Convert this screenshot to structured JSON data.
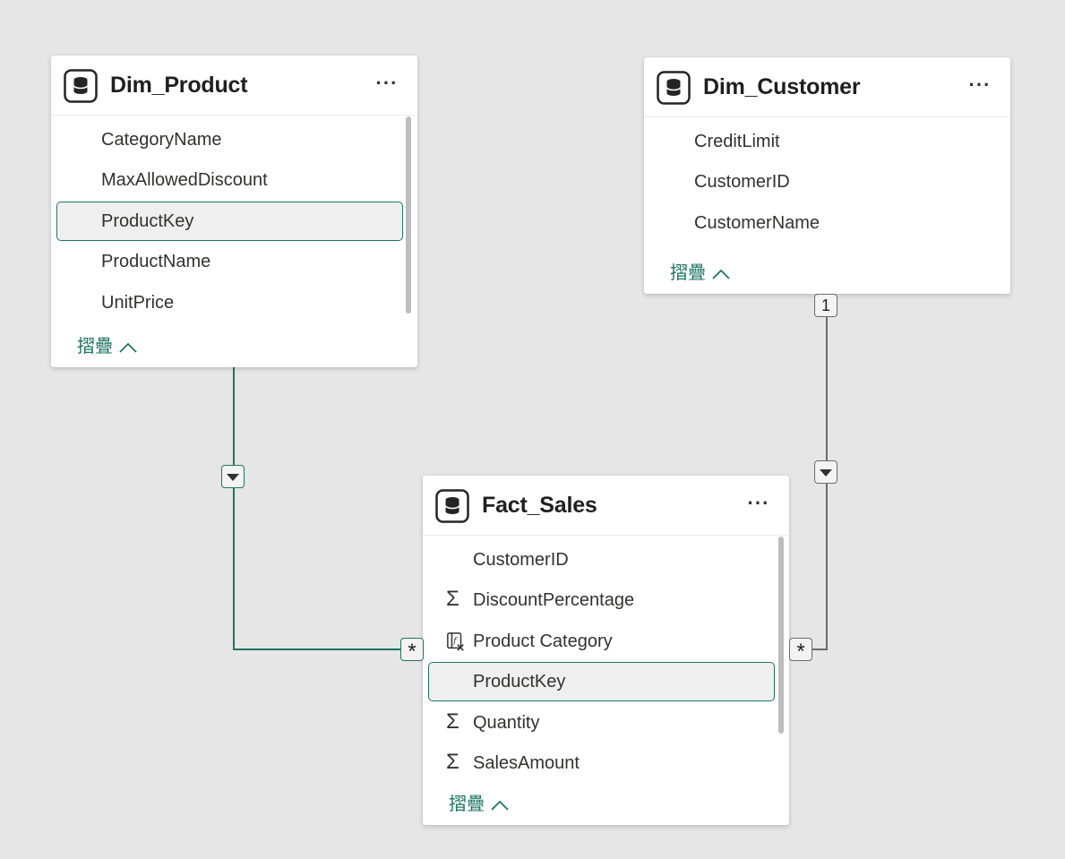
{
  "tables": {
    "dim_product": {
      "title": "Dim_Product",
      "more_label": "···",
      "fields": [
        {
          "name": "CategoryName"
        },
        {
          "name": "MaxAllowedDiscount"
        },
        {
          "name": "ProductKey"
        },
        {
          "name": "ProductName"
        },
        {
          "name": "UnitPrice"
        }
      ],
      "collapse_label": "摺疊"
    },
    "dim_customer": {
      "title": "Dim_Customer",
      "more_label": "···",
      "fields": [
        {
          "name": "CreditLimit"
        },
        {
          "name": "CustomerID"
        },
        {
          "name": "CustomerName"
        }
      ],
      "collapse_label": "摺疊"
    },
    "fact_sales": {
      "title": "Fact_Sales",
      "more_label": "···",
      "fields": [
        {
          "name": "CustomerID"
        },
        {
          "name": "DiscountPercentage",
          "icon": "sigma-icon"
        },
        {
          "name": "Product Category",
          "icon": "calculated-column-icon"
        },
        {
          "name": "ProductKey"
        },
        {
          "name": "Quantity",
          "icon": "sigma-icon"
        },
        {
          "name": "SalesAmount",
          "icon": "sigma-icon"
        }
      ],
      "collapse_label": "摺疊"
    }
  },
  "relationships": {
    "product_to_sales": {
      "from_cardinality": "",
      "to_cardinality": "*",
      "filter_direction": "single",
      "from_field": "ProductKey",
      "to_field": "ProductKey"
    },
    "customer_to_sales": {
      "from_cardinality": "1",
      "to_cardinality": "*",
      "filter_direction": "single",
      "from_field": "CustomerID",
      "to_field": "CustomerID"
    }
  },
  "colors": {
    "canvas": "#e6e6e6",
    "accent": "#1d7563",
    "selected_bg": "#eeefee",
    "neutral_line": "#6b6b6b"
  }
}
